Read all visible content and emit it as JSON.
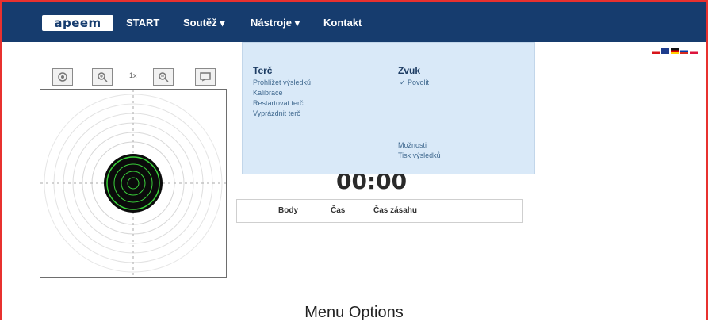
{
  "nav": {
    "logo": "apeem",
    "items": [
      "START",
      "Soutěž ▾",
      "Nástroje ▾",
      "Kontakt"
    ]
  },
  "toolbar": {
    "zoom_label": "1x"
  },
  "dropdown": {
    "col1_heading": "Terč",
    "col1_items": [
      "Prohlížet výsledků",
      "Kalibrace",
      "Restartovat terč",
      "Vyprázdnit terč"
    ],
    "col2_heading": "Zvuk",
    "col2_items": [
      "✓ Povolit"
    ],
    "col2_bottom_items": [
      "Možnosti",
      "Tisk výsledků"
    ]
  },
  "timer": "00:00",
  "results_table": {
    "headers": [
      "Body",
      "Čas",
      "Čas zásahu"
    ]
  },
  "caption": "Menu Options",
  "colors": {
    "navbar": "#163c6e",
    "dropdown_bg": "#d9e9f8",
    "frame_border": "#e8312f",
    "target_center": "#0b0b0b",
    "target_ring": "#3ad13a"
  }
}
